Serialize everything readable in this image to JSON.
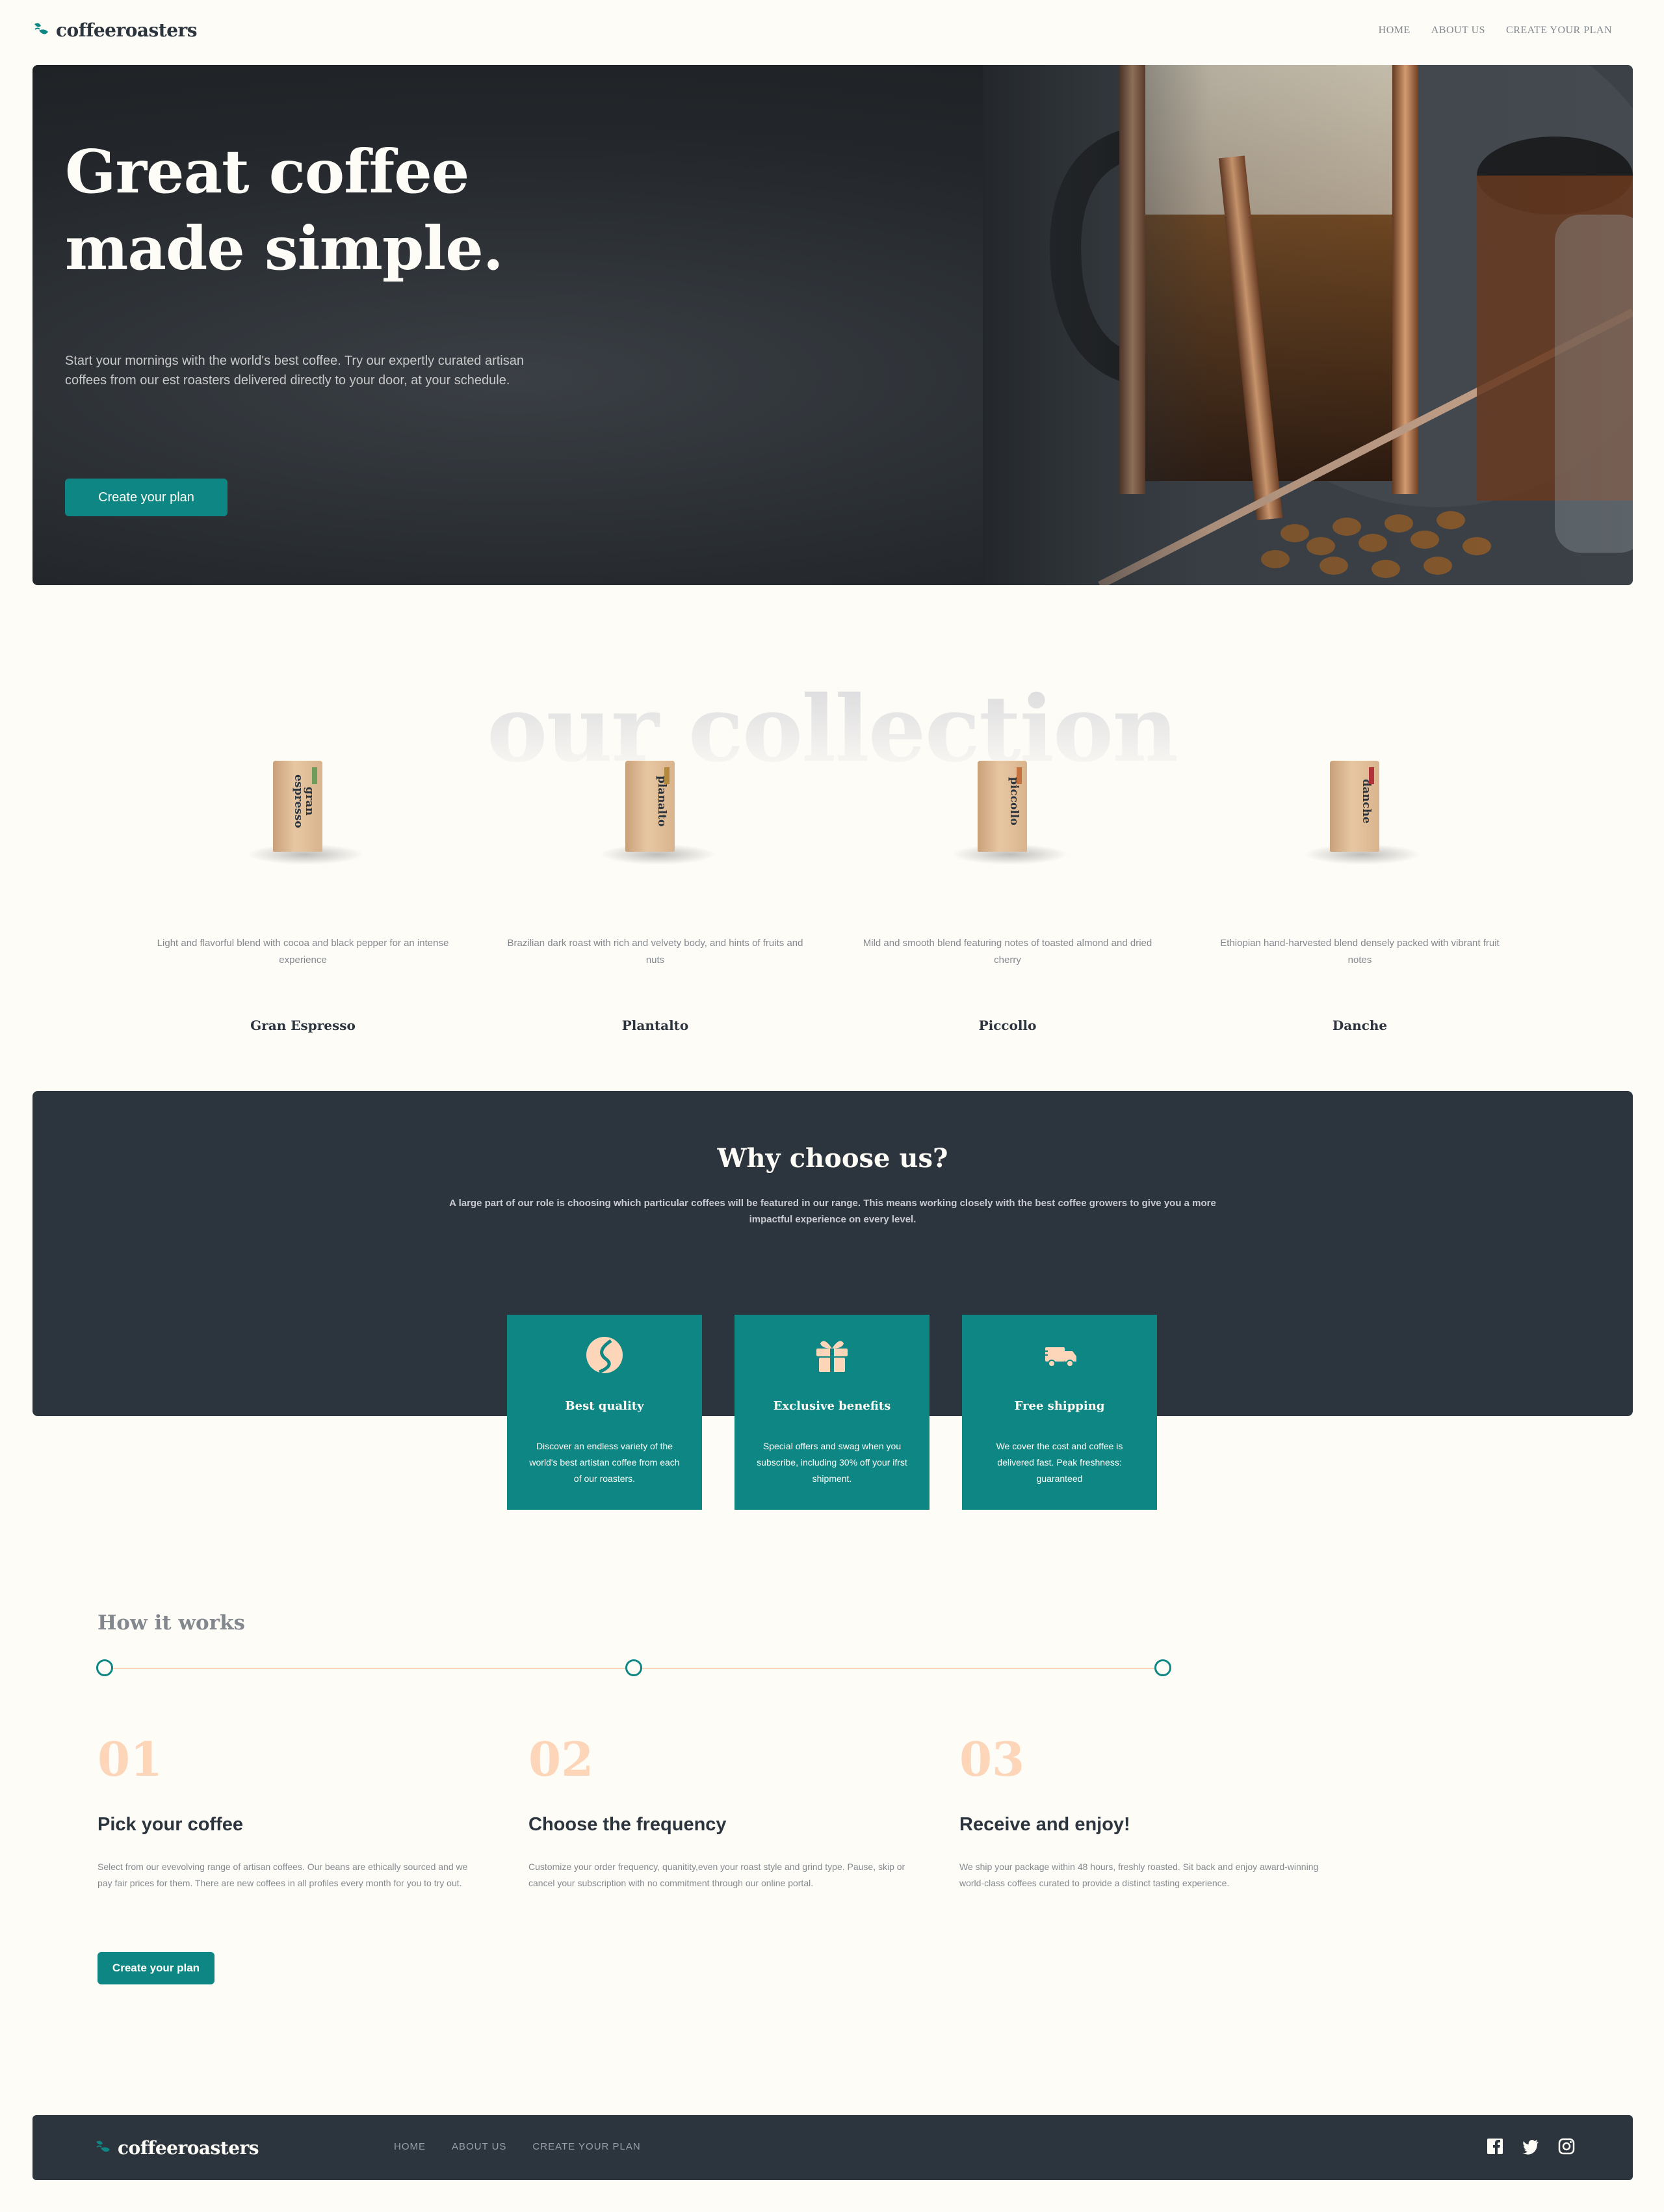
{
  "brand": {
    "name": "coffeeroasters",
    "accent": "#0e8784",
    "dark": "#2c343e",
    "cream": "#fefcf7",
    "peach": "#fdd6ba"
  },
  "nav": {
    "items": [
      "HOME",
      "ABOUT US",
      "CREATE YOUR PLAN"
    ]
  },
  "hero": {
    "title_line1": "Great coffee",
    "title_line2": "made simple.",
    "description": "Start your mornings with the world's best coffee. Try our expertly curated artisan coffees from our est roasters delivered directly to your door, at your schedule.",
    "cta": "Create your plan"
  },
  "collection": {
    "heading": "our collection",
    "products": [
      {
        "name": "Gran Espresso",
        "bag_label": "gran espresso",
        "tag_color": "#6f9b5b",
        "description": "Light and flavorful blend with cocoa and black pepper for an intense experience"
      },
      {
        "name": "Plantalto",
        "bag_label": "planalto",
        "tag_color": "#b38a3d",
        "description": "Brazilian dark roast with rich and velvety body, and hints of fruits and nuts"
      },
      {
        "name": "Piccollo",
        "bag_label": "piccollo",
        "tag_color": "#c2713f",
        "description": "Mild and smooth blend featuring notes of toasted almond and dried cherry"
      },
      {
        "name": "Danche",
        "bag_label": "danche",
        "tag_color": "#b2323a",
        "description": "Ethiopian hand-harvested blend densely packed with vibrant fruit notes"
      }
    ]
  },
  "why": {
    "title": "Why choose us?",
    "description": "A large part of our role is choosing which particular coffees will be featured in our range. This means working closely with the best coffee growers to give you a more impactful experience on every level.",
    "benefits": [
      {
        "icon": "coffee-bean-icon",
        "title": "Best quality",
        "description": "Discover an endless variety of the world's best artistan coffee from each of our roasters."
      },
      {
        "icon": "gift-icon",
        "title": "Exclusive benefits",
        "description": "Special offers and swag when you subscribe, including 30% off your ifrst shipment."
      },
      {
        "icon": "truck-icon",
        "title": "Free shipping",
        "description": "We cover the cost and coffee is delivered fast. Peak freshness: guaranteed"
      }
    ]
  },
  "how": {
    "title": "How it works",
    "steps": [
      {
        "number": "01",
        "title": "Pick your coffee",
        "description": "Select from our evevolving range of artisan coffees. Our beans are ethically sourced and we pay fair prices for them. There are new coffees in all profiles every month for you to try out."
      },
      {
        "number": "02",
        "title": "Choose the frequency",
        "description": "Customize your order frequency, quanitity,even your roast style and grind type. Pause, skip or cancel your subscription with no commitment through our online portal."
      },
      {
        "number": "03",
        "title": "Receive and enjoy!",
        "description": "We ship your package within 48 hours, freshly roasted. Sit back and enjoy award-winning world-class coffees curated to provide a distinct tasting experience."
      }
    ],
    "cta": "Create your plan"
  },
  "footer": {
    "brand": "coffeeroasters",
    "nav": [
      "HOME",
      "ABOUT US",
      "CREATE YOUR PLAN"
    ],
    "social": [
      "facebook-icon",
      "twitter-icon",
      "instagram-icon"
    ]
  }
}
